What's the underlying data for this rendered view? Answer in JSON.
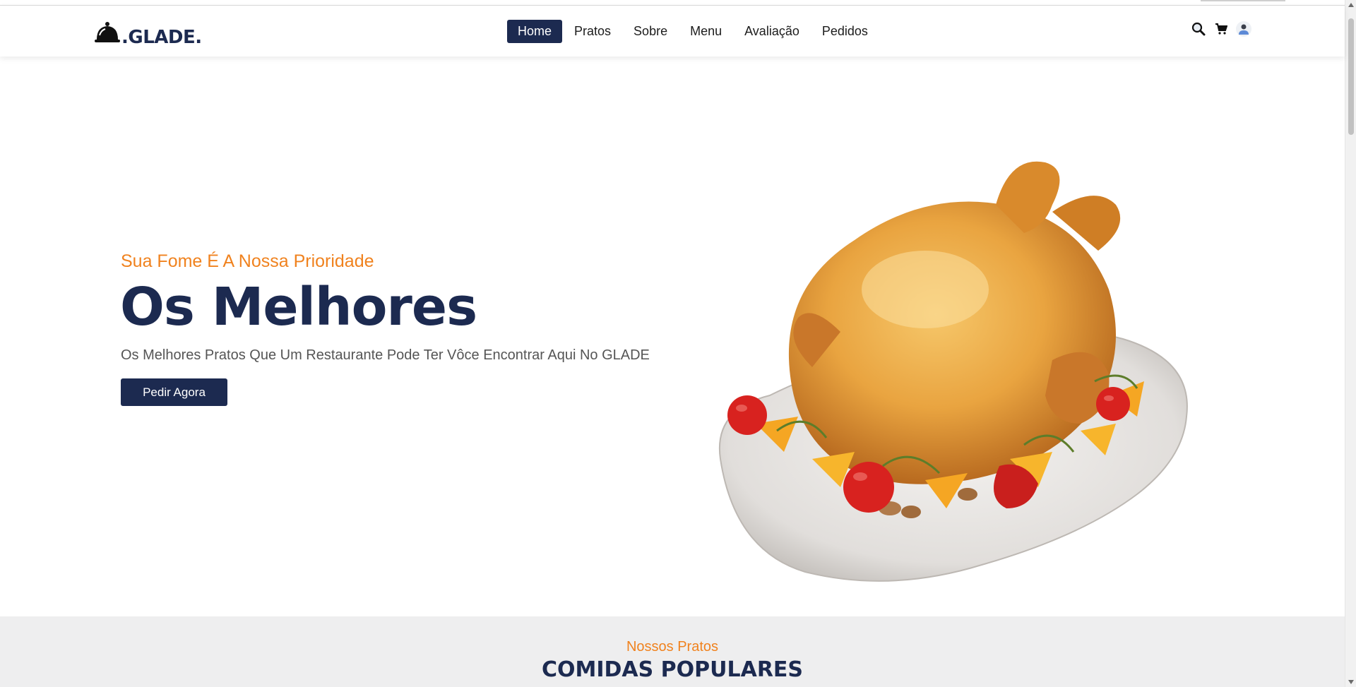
{
  "brand": {
    "logo_text": ".GLADE.",
    "logo_icon": "cloche-icon"
  },
  "nav": {
    "items": [
      {
        "label": "Home",
        "active": true
      },
      {
        "label": "Pratos"
      },
      {
        "label": "Sobre"
      },
      {
        "label": "Menu"
      },
      {
        "label": "Avaliação"
      },
      {
        "label": "Pedidos"
      }
    ]
  },
  "header_icons": [
    "search-icon",
    "cart-icon",
    "user-avatar-icon"
  ],
  "hero": {
    "subtitle": "Sua Fome É A Nossa Prioridade",
    "title": "Os Melhores",
    "description": "Os Melhores Pratos Que Um Restaurante Pode Ter Vôce Encontrar Aqui No GLADE",
    "cta_label": "Pedir Agora",
    "image": "roast-chicken-platter-image"
  },
  "popular": {
    "subtitle": "Nossos Pratos",
    "title": "COMIDAS POPULARES"
  },
  "colors": {
    "primary": "#1c2a50",
    "accent": "#f0821e",
    "section_bg": "#eeeeef"
  }
}
